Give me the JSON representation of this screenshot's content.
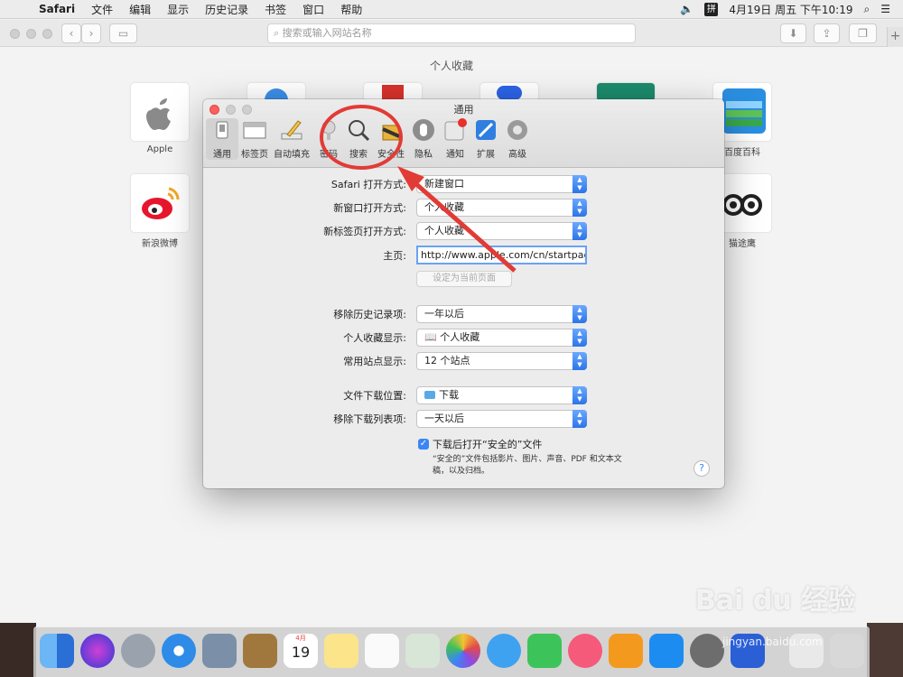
{
  "menubar": {
    "app": "Safari",
    "items": [
      "文件",
      "编辑",
      "显示",
      "历史记录",
      "书签",
      "窗口",
      "帮助"
    ],
    "ime": "拼",
    "clock": "4月19日 周五 下午10:19"
  },
  "toolbar": {
    "address_placeholder": "搜索或输入网站名称"
  },
  "favorites": {
    "title": "个人收藏",
    "tiles": [
      {
        "label": "Apple"
      },
      {
        "label": "百度百科"
      },
      {
        "label": "新浪微博"
      },
      {
        "label": "猫途鹰"
      }
    ]
  },
  "prefs": {
    "title": "通用",
    "tabs": [
      {
        "label": "通用",
        "icon": "general-icon"
      },
      {
        "label": "标签页",
        "icon": "tabs-icon"
      },
      {
        "label": "自动填充",
        "icon": "autofill-icon"
      },
      {
        "label": "密码",
        "icon": "key-icon"
      },
      {
        "label": "搜索",
        "icon": "search-icon"
      },
      {
        "label": "安全性",
        "icon": "security-icon"
      },
      {
        "label": "隐私",
        "icon": "privacy-icon"
      },
      {
        "label": "通知",
        "icon": "notifications-icon"
      },
      {
        "label": "扩展",
        "icon": "extensions-icon"
      },
      {
        "label": "高级",
        "icon": "advanced-icon"
      }
    ],
    "rows": {
      "safari_open_label": "Safari 打开方式:",
      "safari_open_value": "新建窗口",
      "new_window_label": "新窗口打开方式:",
      "new_window_value": "个人收藏",
      "new_tab_label": "新标签页打开方式:",
      "new_tab_value": "个人收藏",
      "homepage_label": "主页:",
      "homepage_value": "http://www.apple.com/cn/startpage",
      "set_current_button": "设定为当前页面",
      "remove_history_label": "移除历史记录项:",
      "remove_history_value": "一年以后",
      "favorites_show_label": "个人收藏显示:",
      "favorites_show_value": "个人收藏",
      "top_sites_label": "常用站点显示:",
      "top_sites_value": "12 个站点",
      "download_location_label": "文件下载位置:",
      "download_location_value": "下载",
      "remove_downloads_label": "移除下载列表项:",
      "remove_downloads_value": "一天以后",
      "open_safe_label": "下载后打开“安全的”文件",
      "open_safe_note": "“安全的”文件包括影片、图片、声音、PDF 和文本文稿，以及归档。"
    }
  },
  "dock": {
    "calendar_month": "4月",
    "calendar_day": "19"
  },
  "watermark": {
    "text": "Bai du 经验",
    "sub": "jingyan.baidu.com"
  },
  "colors": {
    "accent": "#3b86f4",
    "annotation": "#e23b35"
  }
}
